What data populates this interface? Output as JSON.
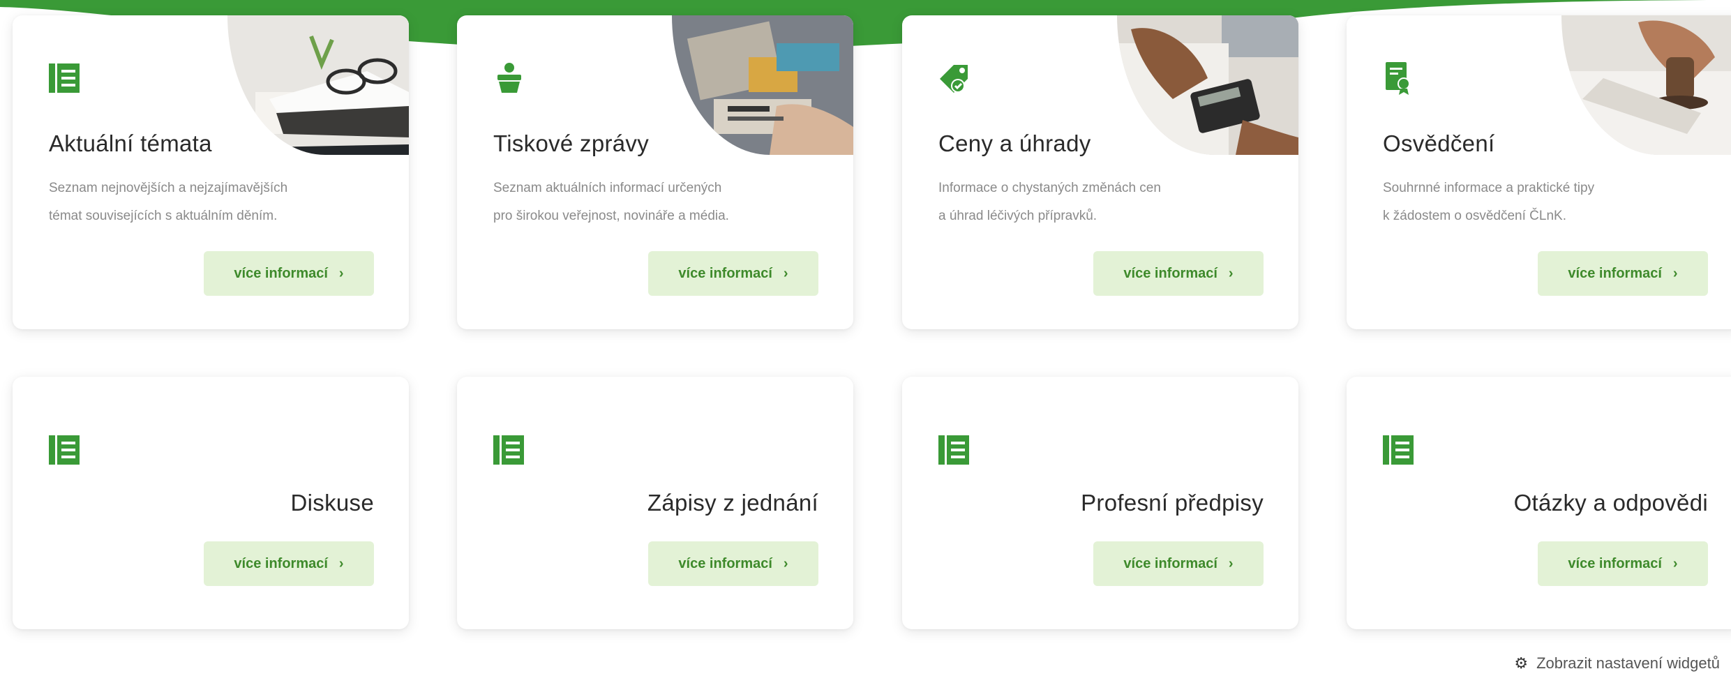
{
  "colors": {
    "brand_green": "#3a9a37",
    "button_bg": "#e3f2d6",
    "button_text": "#3e8a2b"
  },
  "cards": [
    {
      "title": "Aktuální témata",
      "icon": "list-icon",
      "description_line1": "Seznam nejnovějších a nejzajímavějších",
      "description_line2": "témat souvisejících s aktuálním děním.",
      "button_label": "více informací",
      "image": "photo-glasses-documents"
    },
    {
      "title": "Tiskové zprávy",
      "icon": "press-speaker-icon",
      "description_line1": "Seznam aktuálních informací určených",
      "description_line2": "pro širokou veřejnost, novináře a média.",
      "button_label": "více informací",
      "image": "photo-newspaper"
    },
    {
      "title": "Ceny a úhrady",
      "icon": "price-tag-icon",
      "description_line1": "Informace o chystaných změnách cen",
      "description_line2": "a úhrad léčivých přípravků.",
      "button_label": "více informací",
      "image": "photo-calculator"
    },
    {
      "title": "Osvědčení",
      "icon": "certificate-icon",
      "description_line1": "Souhrnné informace a praktické tipy",
      "description_line2": "k žádostem o osvědčení ČLnK.",
      "button_label": "více informací",
      "image": "photo-stamp"
    },
    {
      "title": "Diskuse",
      "icon": "list-icon",
      "button_label": "více informací"
    },
    {
      "title": "Zápisy z jednání",
      "icon": "list-icon",
      "button_label": "více informací"
    },
    {
      "title": "Profesní předpisy",
      "icon": "list-icon",
      "button_label": "více informací"
    },
    {
      "title": "Otázky a odpovědi",
      "icon": "list-icon",
      "button_label": "více informací"
    }
  ],
  "footer": {
    "widget_settings_label": "Zobrazit nastavení widgetů",
    "icon": "gear-icon"
  }
}
